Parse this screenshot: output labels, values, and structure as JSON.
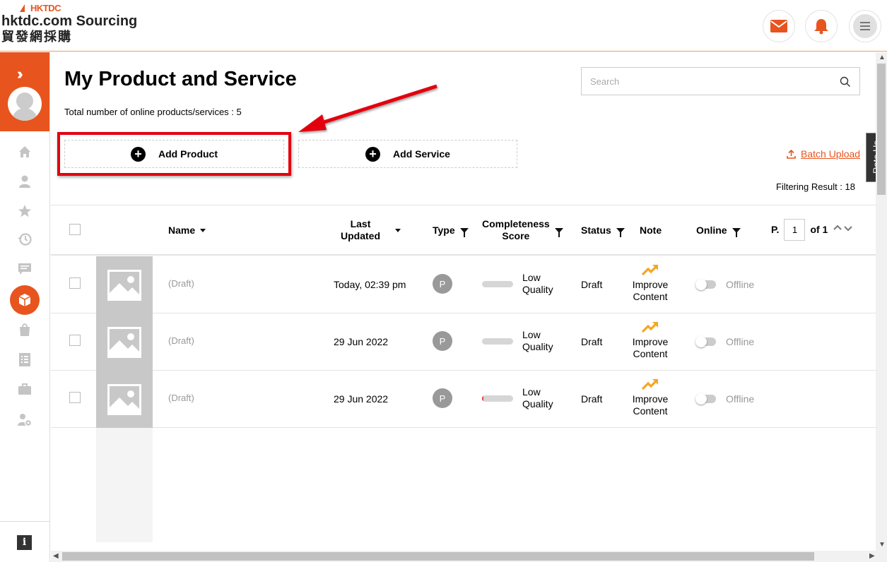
{
  "header": {
    "brand_small": "HKTDC",
    "brand_main": "hktdc.com Sourcing",
    "brand_cn": "貿發網採購"
  },
  "page": {
    "title": "My Product and Service",
    "total_label": "Total number of online products/services : 5",
    "search_placeholder": "Search",
    "add_product_label": "Add Product",
    "add_service_label": "Add Service",
    "batch_upload_label": "Batch Upload",
    "rate_us_label": "Rate Us",
    "filter_result_label": "Filtering Result : 18"
  },
  "table": {
    "columns": {
      "name": "Name",
      "last_updated_1": "Last",
      "last_updated_2": "Updated",
      "type": "Type",
      "completeness_1": "Completeness",
      "completeness_2": "Score",
      "status": "Status",
      "note": "Note",
      "online": "Online",
      "page_prefix": "P.",
      "page_value": "1",
      "page_of": "of 1"
    },
    "rows": [
      {
        "name": "(Draft)",
        "updated": "Today, 02:39 pm",
        "type": "P",
        "score_1": "Low",
        "score_2": "Quality",
        "score_fill": 0,
        "status": "Draft",
        "note_1": "Improve",
        "note_2": "Content",
        "online": "Offline"
      },
      {
        "name": "(Draft)",
        "updated": "29 Jun 2022",
        "type": "P",
        "score_1": "Low",
        "score_2": "Quality",
        "score_fill": 0,
        "status": "Draft",
        "note_1": "Improve",
        "note_2": "Content",
        "online": "Offline"
      },
      {
        "name": "(Draft)",
        "updated": "29 Jun 2022",
        "type": "P",
        "score_1": "Low",
        "score_2": "Quality",
        "score_fill": 0.05,
        "status": "Draft",
        "note_1": "Improve",
        "note_2": "Content",
        "online": "Offline"
      }
    ]
  },
  "sidebar": {
    "icons": [
      "home-icon",
      "user-icon",
      "star-icon",
      "history-icon",
      "message-icon",
      "product-box-icon",
      "shopping-bag-icon",
      "checklist-icon",
      "briefcase-icon",
      "user-settings-icon"
    ],
    "info_label": "i"
  },
  "colors": {
    "brand": "#e8541e",
    "highlight": "#e3000f",
    "note_icon": "#f5a623"
  }
}
